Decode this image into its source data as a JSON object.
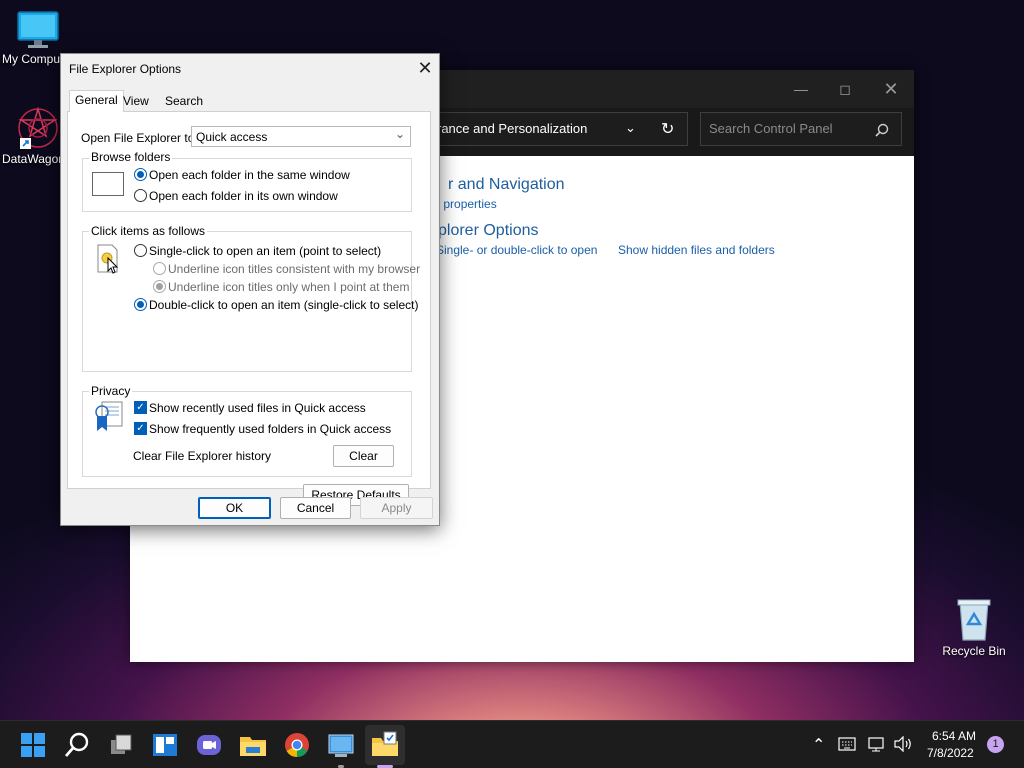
{
  "desktop": {
    "icons": [
      {
        "label": "My Compu"
      },
      {
        "label": "DataWagon"
      },
      {
        "label": "Recycle Bin"
      }
    ]
  },
  "control_panel": {
    "address": "rance and Personalization",
    "search_placeholder": "Search Control Panel",
    "heading1": "r and Navigation",
    "link1": "ion properties",
    "heading2": "plorer Options",
    "link2a": "Single- or double-click to open",
    "link2b": "Show hidden files and folders"
  },
  "dialog": {
    "title": "File Explorer Options",
    "tabs": [
      "General",
      "View",
      "Search"
    ],
    "open_to_label": "Open File Explorer to:",
    "open_to_value": "Quick access",
    "browse_folders": {
      "title": "Browse folders",
      "options": [
        "Open each folder in the same window",
        "Open each folder in its own window"
      ],
      "selected": 0
    },
    "click_items": {
      "title": "Click items as follows",
      "single_click": "Single-click to open an item (point to select)",
      "underline_browser": "Underline icon titles consistent with my browser",
      "underline_point": "Underline icon titles only when I point at them",
      "double_click": "Double-click to open an item (single-click to select)"
    },
    "privacy": {
      "title": "Privacy",
      "recent_files": "Show recently used files in Quick access",
      "frequent_folders": "Show frequently used folders in Quick access",
      "clear_history_label": "Clear File Explorer history",
      "clear_button": "Clear"
    },
    "restore_defaults": "Restore Defaults",
    "ok": "OK",
    "cancel": "Cancel",
    "apply": "Apply"
  },
  "taskbar": {
    "time": "6:54 AM",
    "date": "7/8/2022",
    "notification_count": "1"
  }
}
